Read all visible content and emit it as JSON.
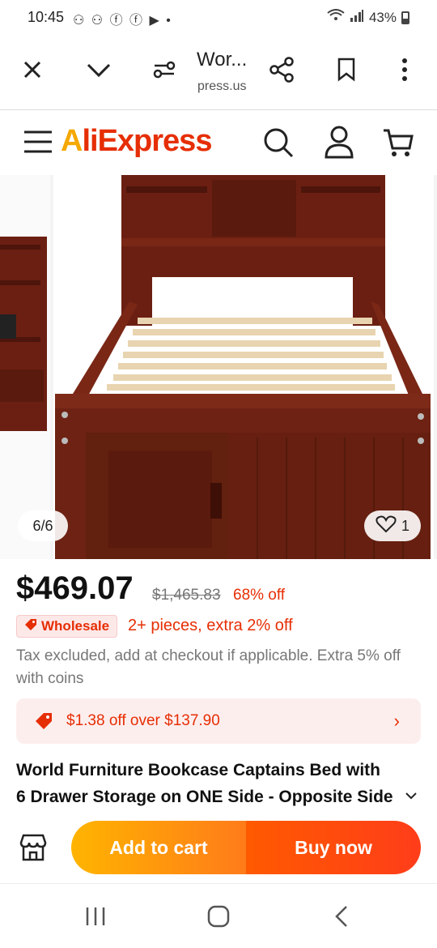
{
  "status": {
    "time": "10:45",
    "notifications": "⚇ ⚇ ⓕ ⓕ ▶ •",
    "battery": "43%"
  },
  "browser": {
    "title": "Wor...",
    "url": "press.us"
  },
  "app": {
    "logo_a": "A",
    "logo_rest": "liExpress"
  },
  "gallery": {
    "counter": "6/6",
    "likes": "1"
  },
  "pricing": {
    "price": "$469.07",
    "original": "$1,465.83",
    "discount": "68% off",
    "wholesale_badge": "Wholesale",
    "wholesale_text": "2+ pieces, extra 2% off",
    "tax_note": "Tax excluded, add at checkout if applicable. Extra 5% off with coins"
  },
  "coupon": {
    "text": "$1.38 off over $137.90"
  },
  "product": {
    "title_line1": "World Furniture Bookcase Captains Bed with",
    "title_line2": "6 Drawer Storage on ONE Side - Opposite Side"
  },
  "actions": {
    "add_to_cart": "Add to cart",
    "buy_now": "Buy now"
  },
  "colors": {
    "accent": "#e62e04",
    "logo_yellow": "#f5a800",
    "wood": "#6b1f12"
  }
}
